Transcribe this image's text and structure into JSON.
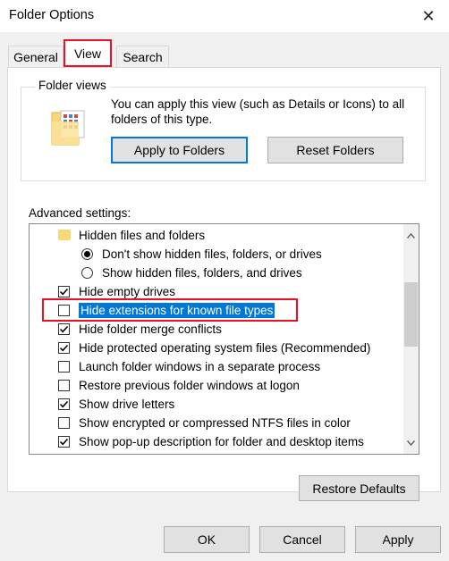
{
  "window": {
    "title": "Folder Options",
    "close_glyph": "✕"
  },
  "tabs": [
    {
      "label": "General",
      "active": false
    },
    {
      "label": "View",
      "active": true
    },
    {
      "label": "Search",
      "active": false
    }
  ],
  "folder_views": {
    "label": "Folder views",
    "icon": "folder-icon",
    "description": "You can apply this view (such as Details or Icons) to all folders of this type.",
    "apply_button": "Apply to Folders",
    "reset_button": "Reset Folders"
  },
  "advanced": {
    "label": "Advanced settings:",
    "items": [
      {
        "type": "group",
        "label": "Hidden files and folders",
        "icon": "folder-icon"
      },
      {
        "type": "radio",
        "label": "Don't show hidden files, folders, or drives",
        "checked": true
      },
      {
        "type": "radio",
        "label": "Show hidden files, folders, and drives",
        "checked": false
      },
      {
        "type": "checkbox",
        "label": "Hide empty drives",
        "checked": true
      },
      {
        "type": "checkbox",
        "label": "Hide extensions for known file types",
        "checked": false,
        "selected": true
      },
      {
        "type": "checkbox",
        "label": "Hide folder merge conflicts",
        "checked": true
      },
      {
        "type": "checkbox",
        "label": "Hide protected operating system files (Recommended)",
        "checked": true
      },
      {
        "type": "checkbox",
        "label": "Launch folder windows in a separate process",
        "checked": false
      },
      {
        "type": "checkbox",
        "label": "Restore previous folder windows at logon",
        "checked": false
      },
      {
        "type": "checkbox",
        "label": "Show drive letters",
        "checked": true
      },
      {
        "type": "checkbox",
        "label": "Show encrypted or compressed NTFS files in color",
        "checked": false
      },
      {
        "type": "checkbox",
        "label": "Show pop-up description for folder and desktop items",
        "checked": true
      }
    ],
    "restore_defaults": "Restore Defaults"
  },
  "footer": {
    "ok": "OK",
    "cancel": "Cancel",
    "apply": "Apply"
  },
  "colors": {
    "highlight": "#e81123",
    "selection": "#0078d7"
  }
}
